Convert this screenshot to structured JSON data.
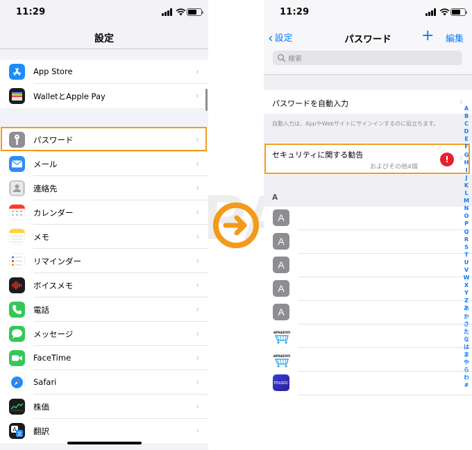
{
  "status": {
    "time": "11:29"
  },
  "left": {
    "nav_title": "設定",
    "group1": [
      {
        "label": "App Store",
        "icon": "app-store-icon",
        "color": "#1e8cf8"
      },
      {
        "label": "WalletとApple Pay",
        "icon": "wallet-icon",
        "color": "#111111"
      }
    ],
    "group2": [
      {
        "label": "パスワード",
        "icon": "key-icon",
        "color": "#8e8e93"
      },
      {
        "label": "メール",
        "icon": "mail-icon",
        "color": "#2f8cf7"
      },
      {
        "label": "連絡先",
        "icon": "contacts-icon",
        "color": "#b8b8bd"
      },
      {
        "label": "カレンダー",
        "icon": "calendar-icon",
        "color": "#ffffff"
      },
      {
        "label": "メモ",
        "icon": "notes-icon",
        "color": "#ffd43b"
      },
      {
        "label": "リマインダー",
        "icon": "reminders-icon",
        "color": "#ffffff"
      },
      {
        "label": "ボイスメモ",
        "icon": "voice-memo-icon",
        "color": "#1c1c1e"
      },
      {
        "label": "電話",
        "icon": "phone-icon",
        "color": "#34c759"
      },
      {
        "label": "メッセージ",
        "icon": "messages-icon",
        "color": "#34c759"
      },
      {
        "label": "FaceTime",
        "icon": "facetime-icon",
        "color": "#34c759"
      },
      {
        "label": "Safari",
        "icon": "safari-icon",
        "color": "#1e8cf8"
      },
      {
        "label": "株価",
        "icon": "stocks-icon",
        "color": "#1c1c1e"
      },
      {
        "label": "翻訳",
        "icon": "translate-icon",
        "color": "#1c1c1e"
      }
    ]
  },
  "right": {
    "back_label": "設定",
    "title": "パスワード",
    "plus": "+",
    "edit_label": "編集",
    "search_placeholder": "検索",
    "autofill_label": "パスワードを自動入力",
    "autofill_note": "自動入力は、AppやWebサイトにサインインするのに役立ちます。",
    "security_label": "セキュリティに関する勧告",
    "security_sub": "およびその他4個",
    "alert_glyph": "!",
    "section_letter": "A",
    "entries": [
      {
        "kind": "letter",
        "glyph": "A"
      },
      {
        "kind": "letter",
        "glyph": "A"
      },
      {
        "kind": "letter",
        "glyph": "A"
      },
      {
        "kind": "letter",
        "glyph": "A"
      },
      {
        "kind": "letter",
        "glyph": "A"
      },
      {
        "kind": "amazon",
        "glyph": "amazon"
      },
      {
        "kind": "amazon",
        "glyph": "amazon"
      },
      {
        "kind": "music",
        "glyph": "music"
      }
    ],
    "index": [
      "A",
      "B",
      "C",
      "D",
      "E",
      "F",
      "G",
      "H",
      "I",
      "J",
      "K",
      "L",
      "M",
      "N",
      "O",
      "P",
      "Q",
      "R",
      "S",
      "T",
      "U",
      "V",
      "W",
      "X",
      "Y",
      "Z",
      "あ",
      "か",
      "さ",
      "た",
      "な",
      "は",
      "ま",
      "や",
      "ら",
      "わ",
      "#"
    ]
  },
  "colors": {
    "accent": "#0a7aff",
    "highlight": "#f39a1a",
    "alert": "#e8202c"
  }
}
